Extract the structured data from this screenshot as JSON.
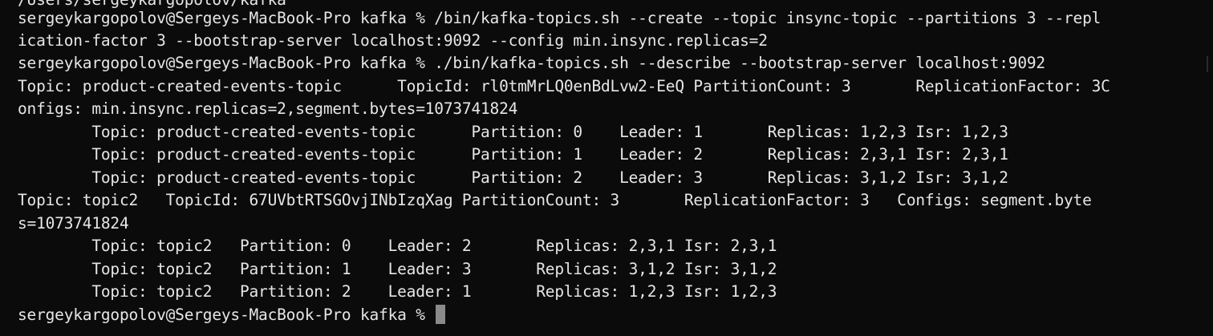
{
  "terminal": {
    "lines": [
      "/Users/sergeykargopolov/kafka",
      "sergeykargopolov@Sergeys-MacBook-Pro kafka % /bin/kafka-topics.sh --create --topic insync-topic --partitions 3 --repl",
      "ication-factor 3 --bootstrap-server localhost:9092 --config min.insync.replicas=2",
      "sergeykargopolov@Sergeys-MacBook-Pro kafka % ./bin/kafka-topics.sh --describe --bootstrap-server localhost:9092",
      "Topic: product-created-events-topic      TopicId: rl0tmMrLQ0enBdLvw2-EeQ PartitionCount: 3       ReplicationFactor: 3C",
      "onfigs: min.insync.replicas=2,segment.bytes=1073741824",
      "        Topic: product-created-events-topic      Partition: 0    Leader: 1       Replicas: 1,2,3 Isr: 1,2,3",
      "        Topic: product-created-events-topic      Partition: 1    Leader: 2       Replicas: 2,3,1 Isr: 2,3,1",
      "        Topic: product-created-events-topic      Partition: 2    Leader: 3       Replicas: 3,1,2 Isr: 3,1,2",
      "Topic: topic2   TopicId: 67UVbtRTSGOvjINbIzqXag PartitionCount: 3       ReplicationFactor: 3   Configs: segment.byte",
      "s=1073741824",
      "        Topic: topic2   Partition: 0    Leader: 2       Replicas: 2,3,1 Isr: 2,3,1",
      "        Topic: topic2   Partition: 1    Leader: 3       Replicas: 3,1,2 Isr: 3,1,2",
      "        Topic: topic2   Partition: 2    Leader: 1       Replicas: 1,2,3 Isr: 1,2,3"
    ],
    "prompt": "sergeykargopolov@Sergeys-MacBook-Pro kafka % "
  }
}
